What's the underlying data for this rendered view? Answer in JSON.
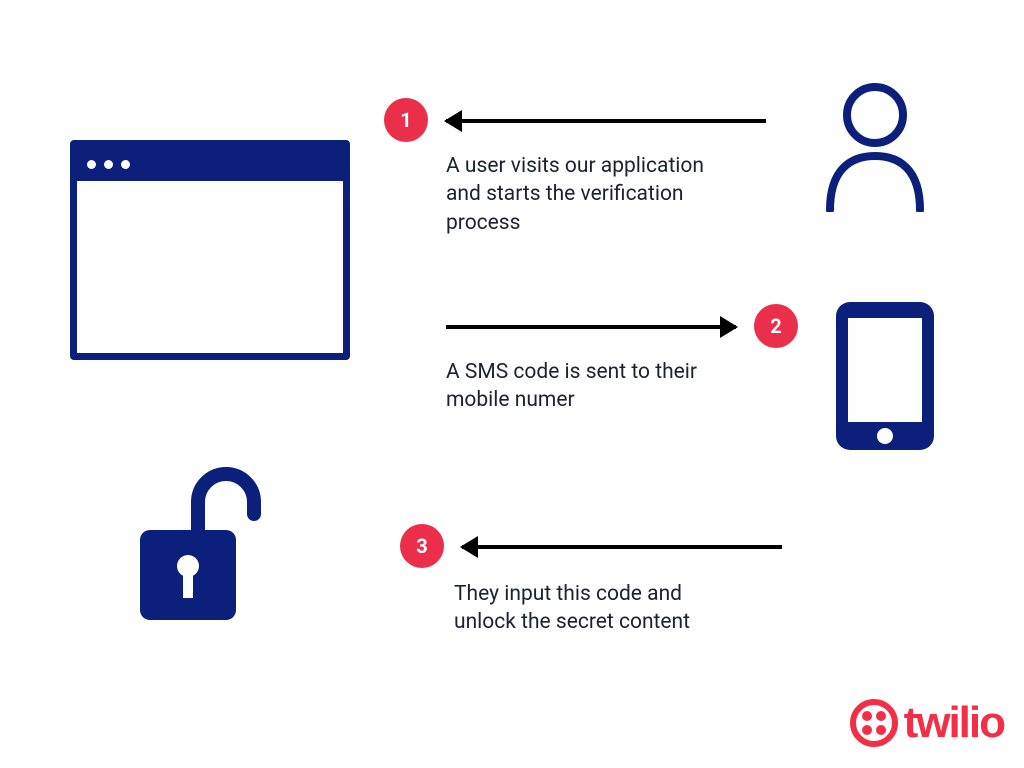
{
  "colors": {
    "ink": "#0c1f7a",
    "badge": "#eb2f4b",
    "text": "#1b2230",
    "brand": "#f22f46"
  },
  "steps": [
    {
      "num": "1",
      "text": "A user visits our application and starts the verification process"
    },
    {
      "num": "2",
      "text": "A SMS code is sent to their mobile numer"
    },
    {
      "num": "3",
      "text": "They input this code and unlock the secret content"
    }
  ],
  "brand": {
    "name": "twilio"
  },
  "icons": {
    "browser": "browser-window-icon",
    "user": "user-icon",
    "phone": "smartphone-icon",
    "lock": "unlocked-padlock-icon",
    "logo": "twilio-logo-icon"
  }
}
